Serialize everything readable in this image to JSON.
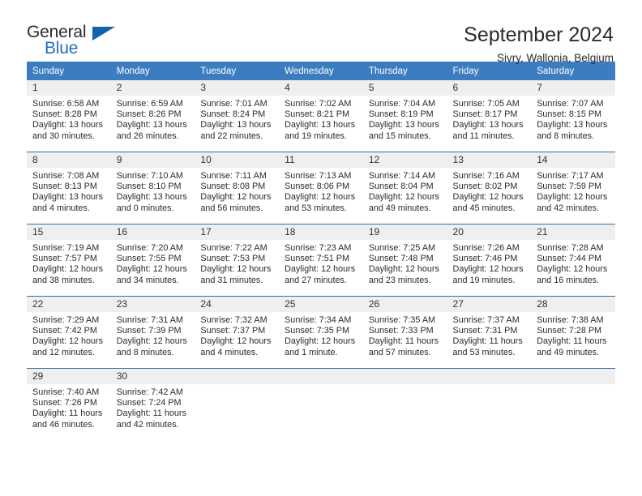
{
  "brand": {
    "name_part1": "General",
    "name_part2": "Blue",
    "flag_icon": "triangle-flag-icon"
  },
  "header": {
    "title": "September 2024",
    "location": "Sivry, Wallonia, Belgium"
  },
  "colors": {
    "header_blue": "#3b7dc0",
    "row_divider_blue": "#2f6fb5",
    "daynum_band_gray": "#efefef",
    "brand_blue": "#1f6fc4",
    "text": "#2b2b2b"
  },
  "weekday_headers": [
    "Sunday",
    "Monday",
    "Tuesday",
    "Wednesday",
    "Thursday",
    "Friday",
    "Saturday"
  ],
  "weeks": [
    [
      {
        "day": "1",
        "sunrise": "Sunrise: 6:58 AM",
        "sunset": "Sunset: 8:28 PM",
        "daylight_line1": "Daylight: 13 hours",
        "daylight_line2": "and 30 minutes."
      },
      {
        "day": "2",
        "sunrise": "Sunrise: 6:59 AM",
        "sunset": "Sunset: 8:26 PM",
        "daylight_line1": "Daylight: 13 hours",
        "daylight_line2": "and 26 minutes."
      },
      {
        "day": "3",
        "sunrise": "Sunrise: 7:01 AM",
        "sunset": "Sunset: 8:24 PM",
        "daylight_line1": "Daylight: 13 hours",
        "daylight_line2": "and 22 minutes."
      },
      {
        "day": "4",
        "sunrise": "Sunrise: 7:02 AM",
        "sunset": "Sunset: 8:21 PM",
        "daylight_line1": "Daylight: 13 hours",
        "daylight_line2": "and 19 minutes."
      },
      {
        "day": "5",
        "sunrise": "Sunrise: 7:04 AM",
        "sunset": "Sunset: 8:19 PM",
        "daylight_line1": "Daylight: 13 hours",
        "daylight_line2": "and 15 minutes."
      },
      {
        "day": "6",
        "sunrise": "Sunrise: 7:05 AM",
        "sunset": "Sunset: 8:17 PM",
        "daylight_line1": "Daylight: 13 hours",
        "daylight_line2": "and 11 minutes."
      },
      {
        "day": "7",
        "sunrise": "Sunrise: 7:07 AM",
        "sunset": "Sunset: 8:15 PM",
        "daylight_line1": "Daylight: 13 hours",
        "daylight_line2": "and 8 minutes."
      }
    ],
    [
      {
        "day": "8",
        "sunrise": "Sunrise: 7:08 AM",
        "sunset": "Sunset: 8:13 PM",
        "daylight_line1": "Daylight: 13 hours",
        "daylight_line2": "and 4 minutes."
      },
      {
        "day": "9",
        "sunrise": "Sunrise: 7:10 AM",
        "sunset": "Sunset: 8:10 PM",
        "daylight_line1": "Daylight: 13 hours",
        "daylight_line2": "and 0 minutes."
      },
      {
        "day": "10",
        "sunrise": "Sunrise: 7:11 AM",
        "sunset": "Sunset: 8:08 PM",
        "daylight_line1": "Daylight: 12 hours",
        "daylight_line2": "and 56 minutes."
      },
      {
        "day": "11",
        "sunrise": "Sunrise: 7:13 AM",
        "sunset": "Sunset: 8:06 PM",
        "daylight_line1": "Daylight: 12 hours",
        "daylight_line2": "and 53 minutes."
      },
      {
        "day": "12",
        "sunrise": "Sunrise: 7:14 AM",
        "sunset": "Sunset: 8:04 PM",
        "daylight_line1": "Daylight: 12 hours",
        "daylight_line2": "and 49 minutes."
      },
      {
        "day": "13",
        "sunrise": "Sunrise: 7:16 AM",
        "sunset": "Sunset: 8:02 PM",
        "daylight_line1": "Daylight: 12 hours",
        "daylight_line2": "and 45 minutes."
      },
      {
        "day": "14",
        "sunrise": "Sunrise: 7:17 AM",
        "sunset": "Sunset: 7:59 PM",
        "daylight_line1": "Daylight: 12 hours",
        "daylight_line2": "and 42 minutes."
      }
    ],
    [
      {
        "day": "15",
        "sunrise": "Sunrise: 7:19 AM",
        "sunset": "Sunset: 7:57 PM",
        "daylight_line1": "Daylight: 12 hours",
        "daylight_line2": "and 38 minutes."
      },
      {
        "day": "16",
        "sunrise": "Sunrise: 7:20 AM",
        "sunset": "Sunset: 7:55 PM",
        "daylight_line1": "Daylight: 12 hours",
        "daylight_line2": "and 34 minutes."
      },
      {
        "day": "17",
        "sunrise": "Sunrise: 7:22 AM",
        "sunset": "Sunset: 7:53 PM",
        "daylight_line1": "Daylight: 12 hours",
        "daylight_line2": "and 31 minutes."
      },
      {
        "day": "18",
        "sunrise": "Sunrise: 7:23 AM",
        "sunset": "Sunset: 7:51 PM",
        "daylight_line1": "Daylight: 12 hours",
        "daylight_line2": "and 27 minutes."
      },
      {
        "day": "19",
        "sunrise": "Sunrise: 7:25 AM",
        "sunset": "Sunset: 7:48 PM",
        "daylight_line1": "Daylight: 12 hours",
        "daylight_line2": "and 23 minutes."
      },
      {
        "day": "20",
        "sunrise": "Sunrise: 7:26 AM",
        "sunset": "Sunset: 7:46 PM",
        "daylight_line1": "Daylight: 12 hours",
        "daylight_line2": "and 19 minutes."
      },
      {
        "day": "21",
        "sunrise": "Sunrise: 7:28 AM",
        "sunset": "Sunset: 7:44 PM",
        "daylight_line1": "Daylight: 12 hours",
        "daylight_line2": "and 16 minutes."
      }
    ],
    [
      {
        "day": "22",
        "sunrise": "Sunrise: 7:29 AM",
        "sunset": "Sunset: 7:42 PM",
        "daylight_line1": "Daylight: 12 hours",
        "daylight_line2": "and 12 minutes."
      },
      {
        "day": "23",
        "sunrise": "Sunrise: 7:31 AM",
        "sunset": "Sunset: 7:39 PM",
        "daylight_line1": "Daylight: 12 hours",
        "daylight_line2": "and 8 minutes."
      },
      {
        "day": "24",
        "sunrise": "Sunrise: 7:32 AM",
        "sunset": "Sunset: 7:37 PM",
        "daylight_line1": "Daylight: 12 hours",
        "daylight_line2": "and 4 minutes."
      },
      {
        "day": "25",
        "sunrise": "Sunrise: 7:34 AM",
        "sunset": "Sunset: 7:35 PM",
        "daylight_line1": "Daylight: 12 hours",
        "daylight_line2": "and 1 minute."
      },
      {
        "day": "26",
        "sunrise": "Sunrise: 7:35 AM",
        "sunset": "Sunset: 7:33 PM",
        "daylight_line1": "Daylight: 11 hours",
        "daylight_line2": "and 57 minutes."
      },
      {
        "day": "27",
        "sunrise": "Sunrise: 7:37 AM",
        "sunset": "Sunset: 7:31 PM",
        "daylight_line1": "Daylight: 11 hours",
        "daylight_line2": "and 53 minutes."
      },
      {
        "day": "28",
        "sunrise": "Sunrise: 7:38 AM",
        "sunset": "Sunset: 7:28 PM",
        "daylight_line1": "Daylight: 11 hours",
        "daylight_line2": "and 49 minutes."
      }
    ],
    [
      {
        "day": "29",
        "sunrise": "Sunrise: 7:40 AM",
        "sunset": "Sunset: 7:26 PM",
        "daylight_line1": "Daylight: 11 hours",
        "daylight_line2": "and 46 minutes."
      },
      {
        "day": "30",
        "sunrise": "Sunrise: 7:42 AM",
        "sunset": "Sunset: 7:24 PM",
        "daylight_line1": "Daylight: 11 hours",
        "daylight_line2": "and 42 minutes."
      },
      {
        "day": "",
        "sunrise": "",
        "sunset": "",
        "daylight_line1": "",
        "daylight_line2": ""
      },
      {
        "day": "",
        "sunrise": "",
        "sunset": "",
        "daylight_line1": "",
        "daylight_line2": ""
      },
      {
        "day": "",
        "sunrise": "",
        "sunset": "",
        "daylight_line1": "",
        "daylight_line2": ""
      },
      {
        "day": "",
        "sunrise": "",
        "sunset": "",
        "daylight_line1": "",
        "daylight_line2": ""
      },
      {
        "day": "",
        "sunrise": "",
        "sunset": "",
        "daylight_line1": "",
        "daylight_line2": ""
      }
    ]
  ]
}
